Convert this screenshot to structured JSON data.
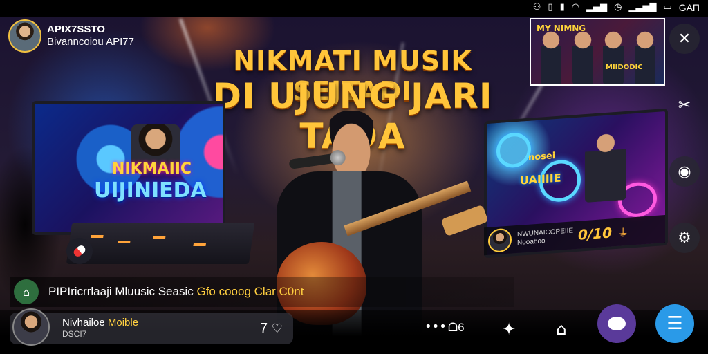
{
  "status_bar": {
    "icons": [
      "nfc-icon",
      "vibrate-icon",
      "notification-icon",
      "wifi-icon",
      "signal-icon",
      "alarm-icon",
      "cellular-icon",
      "battery-icon"
    ],
    "time": "GAП"
  },
  "host": {
    "name": "APIX7SSTO",
    "subtitle": "Bivanncoiou API77"
  },
  "headline": {
    "line1": "NIKMATI MUSIK SEJTADI",
    "line2": "DI UJUNG JARI TÁDA"
  },
  "left_screen": {
    "title": "NIKMAIIC",
    "subtitle": "UIJINIEDA"
  },
  "right_screen": {
    "label": "nosei",
    "title": "UAIIIIE",
    "info_text": "NWUNAICOPEIIE Nooaboo",
    "score": "0/10",
    "plug_icon": "plug-icon"
  },
  "thumbnail": {
    "tag": "MY NIMNG",
    "tag2": "MIIDODIC"
  },
  "notification": {
    "text_prefix": "PIPIricrrlaaji Mluusic Seasic",
    "text_highlight": "Gfo cooog Clar C0nt"
  },
  "bottom_bar": {
    "user_name": "Nivhailoe",
    "user_name_accent": "Moible",
    "user_sub": "DSCI7",
    "count": "7",
    "dots_label": "•••",
    "dots_count": "ᗝ6"
  },
  "colors": {
    "headline": "#ffc53a",
    "accent_yellow": "#ffcf40",
    "chat_button": "#5a3a9a",
    "gift_button": "#2a9ae8"
  }
}
